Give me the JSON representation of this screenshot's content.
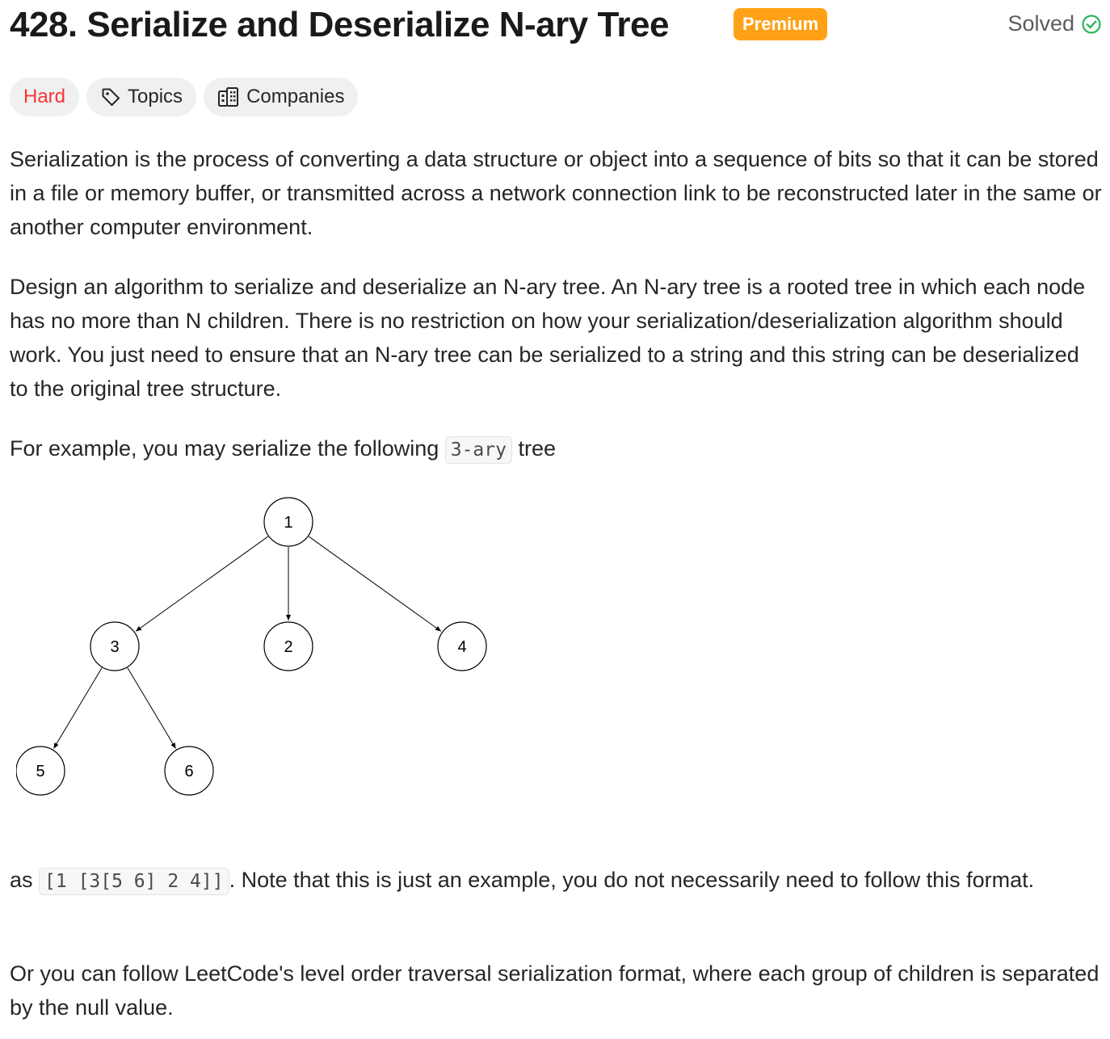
{
  "problem": {
    "title": "428. Serialize and Deserialize N-ary Tree",
    "premium_label": "Premium",
    "status_label": "Solved"
  },
  "tags": {
    "difficulty": "Hard",
    "topics": "Topics",
    "companies": "Companies"
  },
  "description": {
    "p1": "Serialization is the process of converting a data structure or object into a sequence of bits so that it can be stored in a file or memory buffer, or transmitted across a network connection link to be reconstructed later in the same or another computer environment.",
    "p2": "Design an algorithm to serialize and deserialize an N-ary tree. An N-ary tree is a rooted tree in which each node has no more than N children. There is no restriction on how your serialization/deserialization algorithm should work. You just need to ensure that an N-ary tree can be serialized to a string and this string can be deserialized to the original tree structure.",
    "p3_before": "For example, you may serialize the following ",
    "p3_code": "3-ary",
    "p3_after": " tree",
    "p4_before": "as ",
    "p4_code": "[1 [3[5 6] 2 4]]",
    "p4_after": ". Note that this is just an example, you do not necessarily need to follow this format.",
    "p5": "Or you can follow LeetCode's level order traversal serialization format, where each group of children is separated by the null value."
  },
  "tree": {
    "nodes": [
      {
        "id": "1",
        "label": "1"
      },
      {
        "id": "3",
        "label": "3"
      },
      {
        "id": "2",
        "label": "2"
      },
      {
        "id": "4",
        "label": "4"
      },
      {
        "id": "5",
        "label": "5"
      },
      {
        "id": "6",
        "label": "6"
      }
    ],
    "edges": [
      {
        "from": "1",
        "to": "3"
      },
      {
        "from": "1",
        "to": "2"
      },
      {
        "from": "1",
        "to": "4"
      },
      {
        "from": "3",
        "to": "5"
      },
      {
        "from": "3",
        "to": "6"
      }
    ]
  },
  "colors": {
    "premium": "#ffa116",
    "hard": "#f63636",
    "solved_check": "#2db55d"
  }
}
